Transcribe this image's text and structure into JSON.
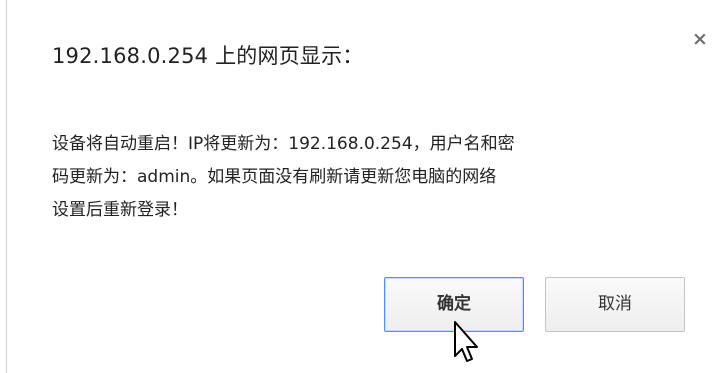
{
  "dialog": {
    "title": "192.168.0.254 上的网页显示：",
    "close_glyph": "×",
    "message_lines": [
      "设备将自动重启！IP将更新为：192.168.0.254，用户名和密",
      "码更新为：admin。如果页面没有刷新请更新您电脑的网络",
      "设置后重新登录！"
    ],
    "ok_label": "确定",
    "cancel_label": "取消"
  },
  "icons": {
    "close": "close-icon",
    "cursor": "mouse-pointer-icon"
  },
  "colors": {
    "focus_border": "#4d90fe",
    "text": "#222222"
  }
}
